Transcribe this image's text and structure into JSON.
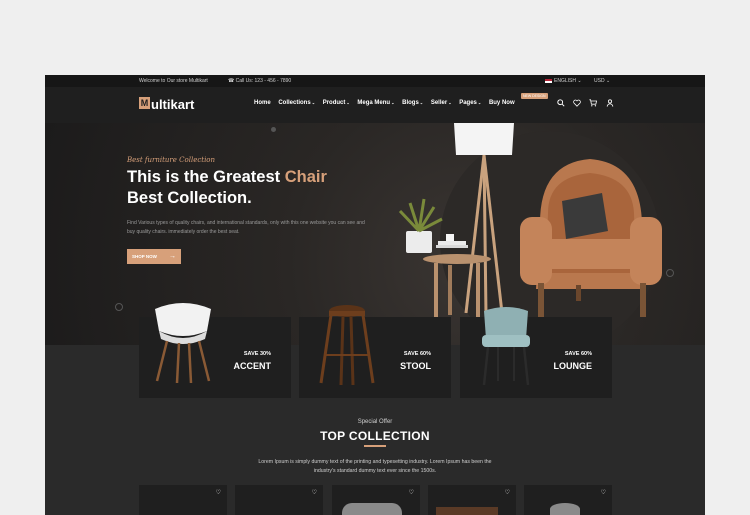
{
  "topbar": {
    "welcome": "Welcome to Our store Multikart",
    "call": "Call Us: 123 - 456 - 7890",
    "language": "ENGLISH",
    "currency": "USD"
  },
  "header": {
    "logo_mark": "M",
    "logo_text": "ultikart",
    "menu": [
      "Home",
      "Collections",
      "Product",
      "Mega Menu",
      "Blogs",
      "Seller",
      "Pages"
    ],
    "buy_now": "Buy Now",
    "new_badge": "NEW DESIGN"
  },
  "hero": {
    "tag": "Best furniture Collection",
    "title_part1": "This is the Greatest ",
    "title_accent": "Chair",
    "title_part2": "Best Collection.",
    "desc": "Find Various types of quality chairs, and international standards, only with this one website you can see and buy quality chairs. immediately order the best seat.",
    "cta": "SHOP NOW"
  },
  "categories": [
    {
      "save": "SAVE 30%",
      "title": "ACCENT"
    },
    {
      "save": "SAVE 60%",
      "title": "STOOL"
    },
    {
      "save": "SAVE 60%",
      "title": "LOUNGE"
    }
  ],
  "collection": {
    "kicker": "Special Offer",
    "title": "TOP COLLECTION",
    "text": "Lorem Ipsum is simply dummy text of the printing and typesetting industry. Lorem Ipsum has been the industry's standard dummy text ever since the 1500s."
  },
  "colors": {
    "accent": "#d7a07a",
    "background": "#2a2a2a"
  }
}
